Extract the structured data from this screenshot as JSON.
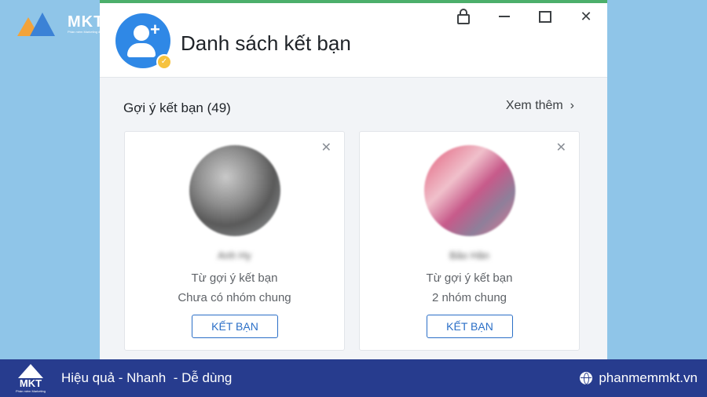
{
  "brand": {
    "name": "MKT",
    "tagline": "Phần mềm Marketing đa kênh"
  },
  "window": {
    "title": "Danh sách kết bạn",
    "controls": [
      "lock-icon",
      "minimize-icon",
      "maximize-icon",
      "close-icon"
    ],
    "accent_color": "#4caf6b"
  },
  "suggestions": {
    "heading": "Gợi ý kết bạn (49)",
    "see_more": "Xem thêm",
    "cards": [
      {
        "name": "Anh Hy",
        "source": "Từ gợi ý kết bạn",
        "mutual": "Chưa có nhóm chung",
        "button": "KẾT BẠN"
      },
      {
        "name": "Bảo Hân",
        "source": "Từ gợi ý kết bạn",
        "mutual": "2 nhóm chung",
        "button": "KẾT BẠN"
      }
    ]
  },
  "footer": {
    "logo_text": "MKT",
    "logo_sub": "Phần mềm Marketing",
    "slogan": "Hiệu quả - Nhanh  - Dễ dùng",
    "website": "phanmemmkt.vn"
  }
}
